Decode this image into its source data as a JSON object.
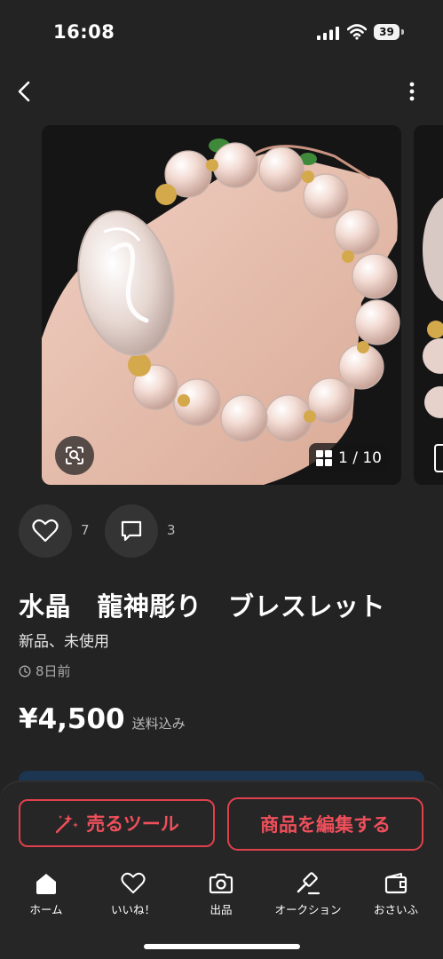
{
  "status_bar": {
    "time": "16:08",
    "battery": "39"
  },
  "gallery": {
    "counter": "1 / 10"
  },
  "reactions": {
    "likes": "7",
    "comments": "3"
  },
  "product": {
    "title": "水晶　龍神彫り　ブレスレット",
    "condition": "新品、未使用",
    "posted": "8日前",
    "price": "¥4,500",
    "shipping": "送料込み"
  },
  "actions": {
    "sell_tool": "売るツール",
    "edit_item": "商品を編集する"
  },
  "tabs": [
    {
      "label": "ホーム",
      "icon": "home-icon"
    },
    {
      "label": "いいね！",
      "icon": "heart-icon"
    },
    {
      "label": "出品",
      "icon": "camera-icon"
    },
    {
      "label": "オークション",
      "icon": "gavel-icon"
    },
    {
      "label": "おさいふ",
      "icon": "wallet-icon"
    }
  ],
  "colors": {
    "background": "#232323",
    "accent": "#e0404c"
  }
}
